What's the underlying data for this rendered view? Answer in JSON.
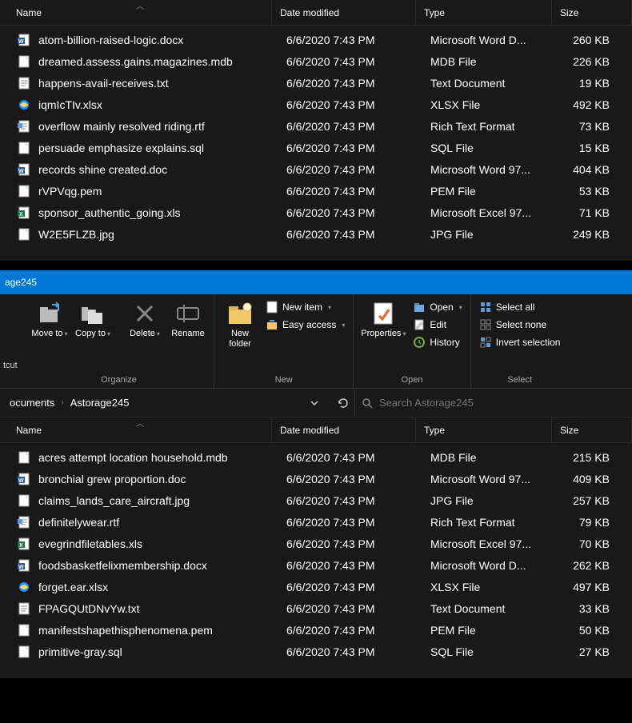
{
  "top_headers": {
    "name": "Name",
    "date": "Date modified",
    "type": "Type",
    "size": "Size"
  },
  "top_files": [
    {
      "icon": "docx",
      "name": "atom-billion-raised-logic.docx",
      "date": "6/6/2020 7:43 PM",
      "type": "Microsoft Word D...",
      "size": "260 KB"
    },
    {
      "icon": "generic",
      "name": "dreamed.assess.gains.magazines.mdb",
      "date": "6/6/2020 7:43 PM",
      "type": "MDB File",
      "size": "226 KB"
    },
    {
      "icon": "txt",
      "name": "happens-avail-receives.txt",
      "date": "6/6/2020 7:43 PM",
      "type": "Text Document",
      "size": "19 KB"
    },
    {
      "icon": "ie",
      "name": "iqmIcTIv.xlsx",
      "date": "6/6/2020 7:43 PM",
      "type": "XLSX File",
      "size": "492 KB"
    },
    {
      "icon": "rtf",
      "name": "overflow mainly resolved riding.rtf",
      "date": "6/6/2020 7:43 PM",
      "type": "Rich Text Format",
      "size": "73 KB"
    },
    {
      "icon": "generic",
      "name": "persuade emphasize explains.sql",
      "date": "6/6/2020 7:43 PM",
      "type": "SQL File",
      "size": "15 KB"
    },
    {
      "icon": "doc",
      "name": "records shine created.doc",
      "date": "6/6/2020 7:43 PM",
      "type": "Microsoft Word 97...",
      "size": "404 KB"
    },
    {
      "icon": "generic",
      "name": "rVPVqg.pem",
      "date": "6/6/2020 7:43 PM",
      "type": "PEM File",
      "size": "53 KB"
    },
    {
      "icon": "xls",
      "name": "sponsor_authentic_going.xls",
      "date": "6/6/2020 7:43 PM",
      "type": "Microsoft Excel 97...",
      "size": "71 KB"
    },
    {
      "icon": "generic",
      "name": "W2E5FLZB.jpg",
      "date": "6/6/2020 7:43 PM",
      "type": "JPG File",
      "size": "249 KB"
    }
  ],
  "title_bar": {
    "text": "age245"
  },
  "ribbon": {
    "cut_left": "tcut",
    "organize": {
      "move_to": "Move to",
      "copy_to": "Copy to",
      "delete": "Delete",
      "rename": "Rename",
      "label": "Organize"
    },
    "new": {
      "new_folder": "New folder",
      "new_item": "New item",
      "easy_access": "Easy access",
      "label": "New"
    },
    "open": {
      "properties": "Properties",
      "open": "Open",
      "edit": "Edit",
      "history": "History",
      "label": "Open"
    },
    "select": {
      "select_all": "Select all",
      "select_none": "Select none",
      "invert": "Invert selection",
      "label": "Select"
    }
  },
  "breadcrumb": {
    "p1": "ocuments",
    "p2": "Astorage245"
  },
  "search": {
    "placeholder": "Search Astorage245"
  },
  "bottom_headers": {
    "name": "Name",
    "date": "Date modified",
    "type": "Type",
    "size": "Size"
  },
  "bottom_files": [
    {
      "icon": "generic",
      "name": "acres attempt location household.mdb",
      "date": "6/6/2020 7:43 PM",
      "type": "MDB File",
      "size": "215 KB"
    },
    {
      "icon": "doc",
      "name": "bronchial grew proportion.doc",
      "date": "6/6/2020 7:43 PM",
      "type": "Microsoft Word 97...",
      "size": "409 KB"
    },
    {
      "icon": "generic",
      "name": "claims_lands_care_aircraft.jpg",
      "date": "6/6/2020 7:43 PM",
      "type": "JPG File",
      "size": "257 KB"
    },
    {
      "icon": "rtf",
      "name": "definitelywear.rtf",
      "date": "6/6/2020 7:43 PM",
      "type": "Rich Text Format",
      "size": "79 KB"
    },
    {
      "icon": "xls",
      "name": "evegrindfiletables.xls",
      "date": "6/6/2020 7:43 PM",
      "type": "Microsoft Excel 97...",
      "size": "70 KB"
    },
    {
      "icon": "docx",
      "name": "foodsbasketfelixmembership.docx",
      "date": "6/6/2020 7:43 PM",
      "type": "Microsoft Word D...",
      "size": "262 KB"
    },
    {
      "icon": "ie",
      "name": "forget.ear.xlsx",
      "date": "6/6/2020 7:43 PM",
      "type": "XLSX File",
      "size": "497 KB"
    },
    {
      "icon": "txt",
      "name": "FPAGQUtDNvYw.txt",
      "date": "6/6/2020 7:43 PM",
      "type": "Text Document",
      "size": "33 KB"
    },
    {
      "icon": "generic",
      "name": "manifestshapethisphenomena.pem",
      "date": "6/6/2020 7:43 PM",
      "type": "PEM File",
      "size": "50 KB"
    },
    {
      "icon": "generic",
      "name": "primitive-gray.sql",
      "date": "6/6/2020 7:43 PM",
      "type": "SQL File",
      "size": "27 KB"
    }
  ]
}
